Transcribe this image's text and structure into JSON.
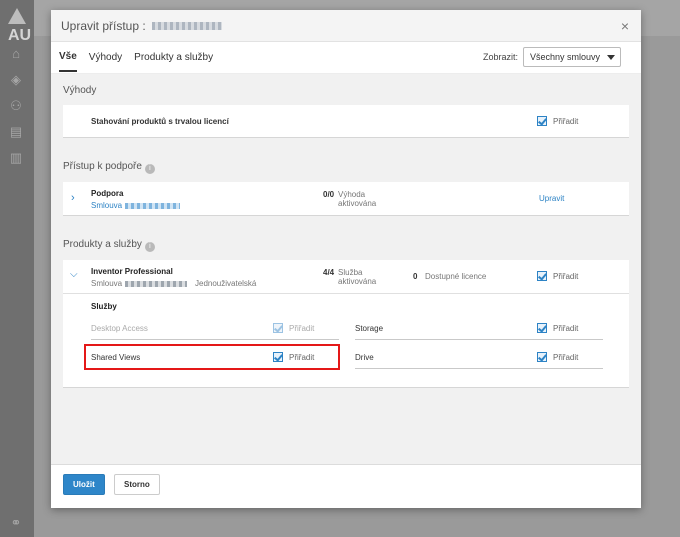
{
  "app": {
    "logo_text": "AU"
  },
  "modal": {
    "title": "Upravit přístup :",
    "close": "×"
  },
  "tabs": [
    {
      "label": "Vše"
    },
    {
      "label": "Výhody"
    },
    {
      "label": "Produkty a služby"
    }
  ],
  "filter": {
    "label": "Zobrazit:",
    "value": "Všechny smlouvy"
  },
  "benefits": {
    "title": "Výhody",
    "item": {
      "name": "Stahování produktů s trvalou licencí",
      "check_label": "Přiřadit"
    }
  },
  "support": {
    "title": "Přístup k podpoře",
    "info": "i",
    "item": {
      "name": "Podpora",
      "contract": "Smlouva",
      "count": "0/0",
      "count_label": "Výhoda aktivována",
      "action": "Upravit"
    }
  },
  "products": {
    "title": "Produkty a služby",
    "info": "i",
    "item": {
      "name": "Inventor Professional",
      "contract": "Smlouva",
      "license_type": "Jednouživatelská",
      "count": "4/4",
      "count_label": "Služba aktivována",
      "available_count": "0",
      "available_label": "Dostupné licence",
      "check_label": "Přiřadit"
    },
    "services": {
      "title": "Služby",
      "items": [
        {
          "name": "Desktop Access",
          "check_label": "Přiřadit",
          "disabled": true
        },
        {
          "name": "Storage",
          "check_label": "Přiřadit",
          "disabled": false
        },
        {
          "name": "Shared Views",
          "check_label": "Přiřadit",
          "disabled": false
        },
        {
          "name": "Drive",
          "check_label": "Přiřadit",
          "disabled": false
        }
      ]
    }
  },
  "footer": {
    "save": "Uložit",
    "cancel": "Storno"
  },
  "colors": {
    "accent": "#2d83c5",
    "highlight": "#e41818",
    "primary_button": "#2e86c9"
  }
}
